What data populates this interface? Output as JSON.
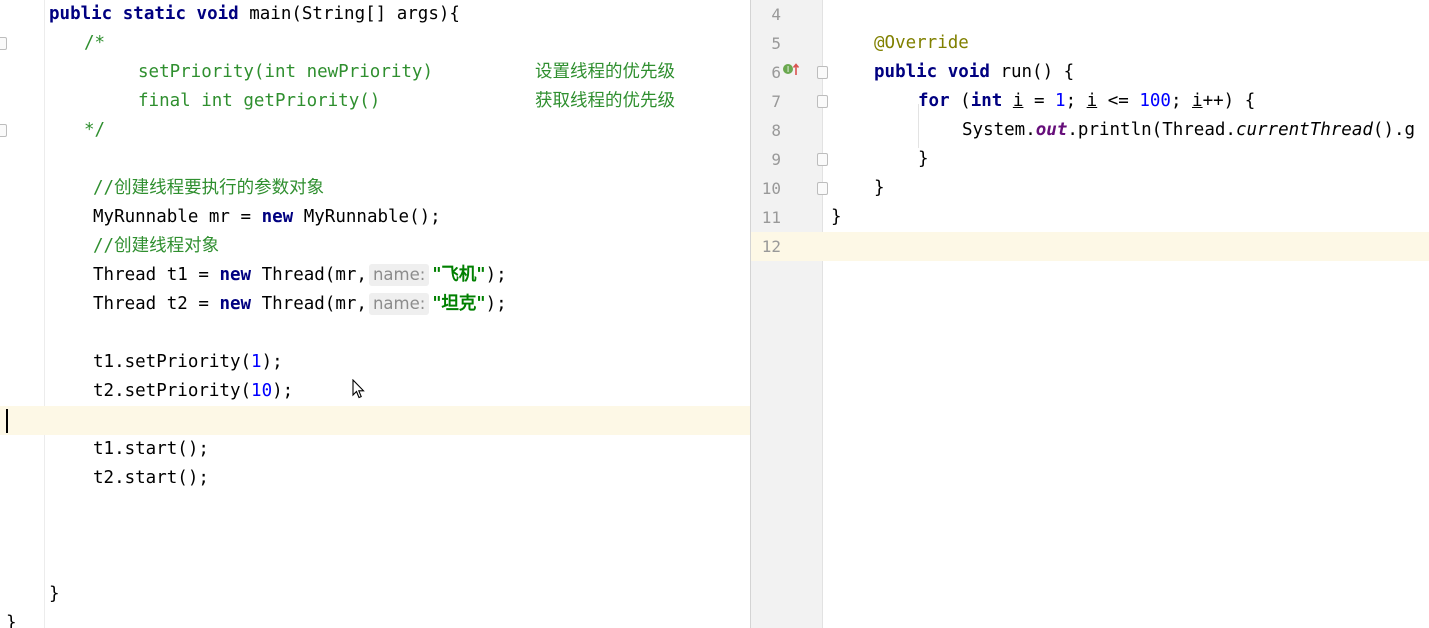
{
  "left_editor": {
    "lines": [
      {
        "parts": [
          {
            "t": "public ",
            "c": "kw"
          },
          {
            "t": "static ",
            "c": "kw"
          },
          {
            "t": "void ",
            "c": "kw"
          },
          {
            "t": "main(String[] args){",
            "c": ""
          }
        ]
      },
      {
        "parts": [
          {
            "t": "/*",
            "c": "green"
          }
        ]
      },
      {
        "parts": [
          {
            "t": "setPriority(int newPriority)",
            "c": "green"
          }
        ],
        "cjk": "设置线程的优先级"
      },
      {
        "parts": [
          {
            "t": "final int getPriority()",
            "c": "green"
          }
        ],
        "cjk": "获取线程的优先级"
      },
      {
        "parts": [
          {
            "t": "*/",
            "c": "green"
          }
        ]
      },
      {
        "parts": []
      },
      {
        "parts": [
          {
            "t": "//创建线程要执行的参数对象",
            "c": "green"
          }
        ]
      },
      {
        "parts": [
          {
            "t": "MyRunnable mr = ",
            "c": ""
          },
          {
            "t": "new ",
            "c": "kw"
          },
          {
            "t": "MyRunnable();",
            "c": ""
          }
        ]
      },
      {
        "parts": [
          {
            "t": "//创建线程对象",
            "c": "green"
          }
        ]
      },
      {
        "parts": [
          {
            "t": "Thread t1 = ",
            "c": ""
          },
          {
            "t": "new ",
            "c": "kw"
          },
          {
            "t": "Thread(mr,",
            "c": ""
          }
        ],
        "hint": "name:",
        "str": "\"飞机\"",
        "tail": ");"
      },
      {
        "parts": [
          {
            "t": "Thread t2 = ",
            "c": ""
          },
          {
            "t": "new ",
            "c": "kw"
          },
          {
            "t": "Thread(mr,",
            "c": ""
          }
        ],
        "hint": "name:",
        "str": "\"坦克\"",
        "tail": ");"
      },
      {
        "parts": []
      },
      {
        "parts": [
          {
            "t": "t1.setPriority(",
            "c": ""
          },
          {
            "t": "1",
            "c": "num"
          },
          {
            "t": ");",
            "c": ""
          }
        ]
      },
      {
        "parts": [
          {
            "t": "t2.setPriority(",
            "c": ""
          },
          {
            "t": "10",
            "c": "num"
          },
          {
            "t": ");",
            "c": ""
          }
        ]
      },
      {
        "parts": []
      },
      {
        "parts": [
          {
            "t": "t1.start();",
            "c": ""
          }
        ]
      },
      {
        "parts": [
          {
            "t": "t2.start();",
            "c": ""
          }
        ]
      },
      {
        "parts": []
      },
      {
        "parts": []
      },
      {
        "parts": []
      },
      {
        "parts": [
          {
            "t": "}",
            "c": ""
          }
        ]
      },
      {
        "parts": [
          {
            "t": "}",
            "c": ""
          }
        ]
      }
    ]
  },
  "right_editor": {
    "line_numbers": [
      "4",
      "5",
      "6",
      "7",
      "8",
      "9",
      "10",
      "11",
      "12"
    ],
    "lines": [
      {
        "parts": []
      },
      {
        "parts": [
          {
            "t": "@Override",
            "c": "ann"
          }
        ]
      },
      {
        "parts": [
          {
            "t": "public ",
            "c": "kw"
          },
          {
            "t": "void ",
            "c": "kw"
          },
          {
            "t": "run() {",
            "c": ""
          }
        ]
      },
      {
        "parts": [
          {
            "t": "for ",
            "c": "kw"
          },
          {
            "t": "(",
            "c": ""
          },
          {
            "t": "int ",
            "c": "kw"
          },
          {
            "t": "i",
            "c": "ul"
          },
          {
            "t": " = ",
            "c": ""
          },
          {
            "t": "1",
            "c": "num"
          },
          {
            "t": "; ",
            "c": ""
          },
          {
            "t": "i",
            "c": "ul"
          },
          {
            "t": " <= ",
            "c": ""
          },
          {
            "t": "100",
            "c": "num"
          },
          {
            "t": "; ",
            "c": ""
          },
          {
            "t": "i",
            "c": "ul"
          },
          {
            "t": "++) {",
            "c": ""
          }
        ]
      },
      {
        "parts": [
          {
            "t": "System.",
            "c": ""
          },
          {
            "t": "out",
            "c": "field"
          },
          {
            "t": ".println(Thread.",
            "c": ""
          },
          {
            "t": "currentThread",
            "c": "italic"
          },
          {
            "t": "().g",
            "c": ""
          }
        ]
      },
      {
        "parts": [
          {
            "t": "}",
            "c": ""
          }
        ]
      },
      {
        "parts": [
          {
            "t": "}",
            "c": ""
          }
        ]
      },
      {
        "parts": [
          {
            "t": "}",
            "c": ""
          }
        ]
      },
      {
        "parts": []
      }
    ]
  },
  "colors": {
    "keyword": "#000080",
    "number": "#0000ff",
    "comment": "#2f8f2f",
    "string": "#008000",
    "annotation": "#808000",
    "current_line": "#fdf8e6"
  },
  "icons": [
    "override-method-icon",
    "fold-marker-icon",
    "mouse-cursor-icon"
  ]
}
